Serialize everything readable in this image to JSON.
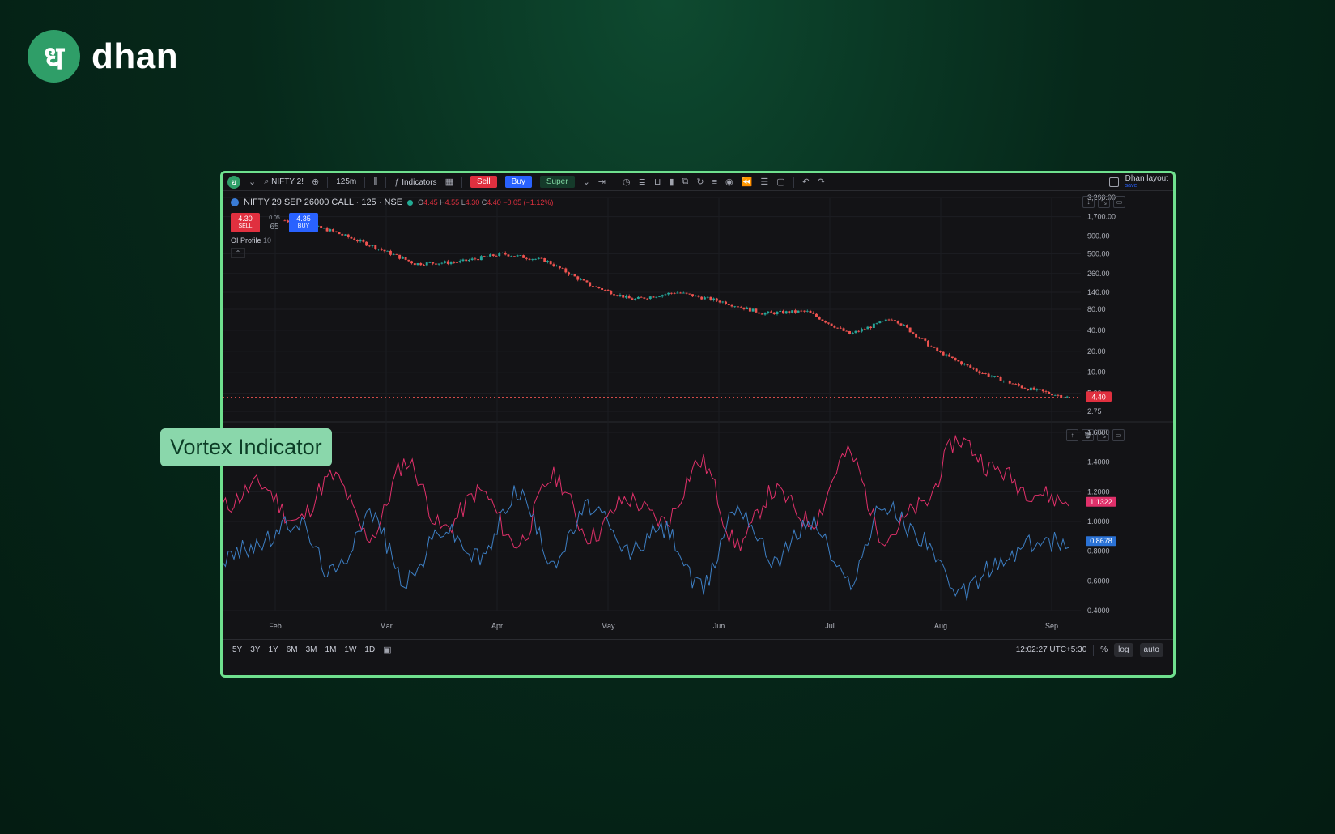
{
  "brand": {
    "logo_glyph": "ध",
    "name": "dhan"
  },
  "toolbar": {
    "symbol": "NIFTY 2!",
    "interval": "125m",
    "indicators_label": "Indicators",
    "sell_label": "Sell",
    "buy_label": "Buy",
    "super_label": "Super",
    "layout_label": "Dhan layout",
    "layout_save": "save"
  },
  "legend": {
    "title": "NIFTY 29 SEP 26000 CALL · 125 · NSE",
    "o_label": "O",
    "o": "4.45",
    "h_label": "H",
    "h": "4.55",
    "l_label": "L",
    "l": "4.30",
    "c_label": "C",
    "c": "4.40",
    "change": "−0.05 (−1.12%)"
  },
  "quote": {
    "sell_price": "4.30",
    "sell_label": "SELL",
    "spread": "0.05",
    "qty": "65",
    "buy_price": "4.35",
    "buy_label": "BUY"
  },
  "oi_profile": {
    "label": "OI Profile",
    "value": "10"
  },
  "price_axis": [
    "3,200.00",
    "1,700.00",
    "900.00",
    "500.00",
    "260.00",
    "140.00",
    "80.00",
    "40.00",
    "20.00",
    "10.00",
    "5.00",
    "2.75"
  ],
  "last_price_tag": "4.40",
  "vortex_axis": [
    "1.6000",
    "1.4000",
    "1.2000",
    "1.0000",
    "0.8000",
    "0.6000",
    "0.4000"
  ],
  "vi_plus_tag": "1.1322",
  "vi_minus_tag": "0.8678",
  "time_axis": [
    "Feb",
    "Mar",
    "Apr",
    "May",
    "Jun",
    "Jul",
    "Aug",
    "Sep"
  ],
  "footer": {
    "ranges": [
      "5Y",
      "3Y",
      "1Y",
      "6M",
      "3M",
      "1M",
      "1W",
      "1D"
    ],
    "clock": "12:02:27 UTC+5:30",
    "pct": "%",
    "log": "log",
    "auto": "auto"
  },
  "callout": "Vortex Indicator",
  "colors": {
    "up": "#26a69a",
    "down": "#ef5350",
    "vi_plus": "#e0306a",
    "vi_minus": "#3d7fc4",
    "accent": "#6fe08e"
  },
  "chart_data": [
    {
      "type": "candlestick",
      "scale": "log",
      "ylim": [
        2.75,
        3200
      ],
      "x": [
        "Feb",
        "Mar",
        "Apr",
        "May",
        "Jun",
        "Jul",
        "Aug",
        "Sep"
      ],
      "values": [
        1500,
        1100,
        650,
        360,
        380,
        500,
        400,
        180,
        110,
        140,
        105,
        70,
        75,
        35,
        60,
        20,
        10,
        6,
        4.4
      ],
      "last": 4.4
    },
    {
      "type": "line",
      "title": "Vortex Indicator",
      "ylim": [
        0.4,
        1.6
      ],
      "x": [
        "Feb",
        "Mar",
        "Apr",
        "May",
        "Jun",
        "Jul",
        "Aug",
        "Sep"
      ],
      "series": [
        {
          "color": "#e0306a",
          "values": [
            1.1,
            1.25,
            1.0,
            1.3,
            0.9,
            1.4,
            0.95,
            1.2,
            0.85,
            1.3,
            0.9,
            1.15,
            1.0,
            1.4,
            0.85,
            1.2,
            1.0,
            1.45,
            0.9,
            1.1,
            1.55,
            1.35,
            1.2,
            1.1322
          ]
        },
        {
          "color": "#3d7fc4",
          "values": [
            0.75,
            0.85,
            1.0,
            0.65,
            1.05,
            0.6,
            0.95,
            0.75,
            1.2,
            0.75,
            1.1,
            0.8,
            0.95,
            0.55,
            1.1,
            0.75,
            1.0,
            0.6,
            1.1,
            0.9,
            0.5,
            0.7,
            0.85,
            0.8678
          ]
        }
      ]
    }
  ]
}
